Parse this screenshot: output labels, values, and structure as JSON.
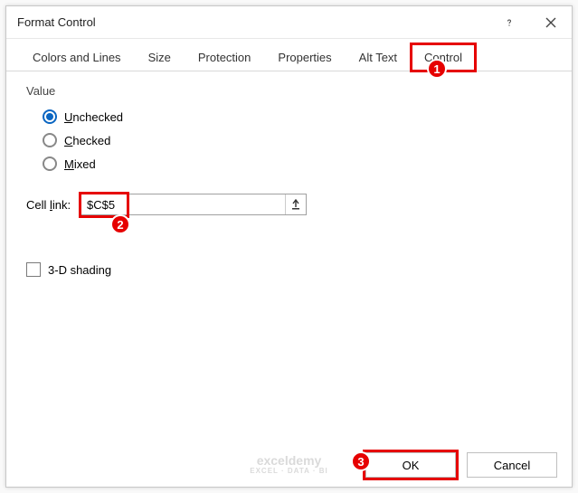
{
  "title": "Format Control",
  "tabs": {
    "colors": "Colors and Lines",
    "size": "Size",
    "protection": "Protection",
    "properties": "Properties",
    "alttext": "Alt Text",
    "control": "Control"
  },
  "value": {
    "group_label": "Value",
    "unchecked": {
      "u": "U",
      "rest": "nchecked"
    },
    "checked": {
      "u": "C",
      "rest": "hecked"
    },
    "mixed": {
      "u": "M",
      "rest": "ixed"
    }
  },
  "cell_link": {
    "label_pre": "Cell ",
    "label_u": "l",
    "label_post": "ink:",
    "value": "$C$5"
  },
  "shading": {
    "u": "3",
    "rest": "-D shading"
  },
  "buttons": {
    "ok": "OK",
    "cancel": "Cancel"
  },
  "callouts": {
    "one": "1",
    "two": "2",
    "three": "3"
  },
  "watermark": {
    "t1": "exceldemy",
    "t2": "EXCEL · DATA · BI"
  }
}
